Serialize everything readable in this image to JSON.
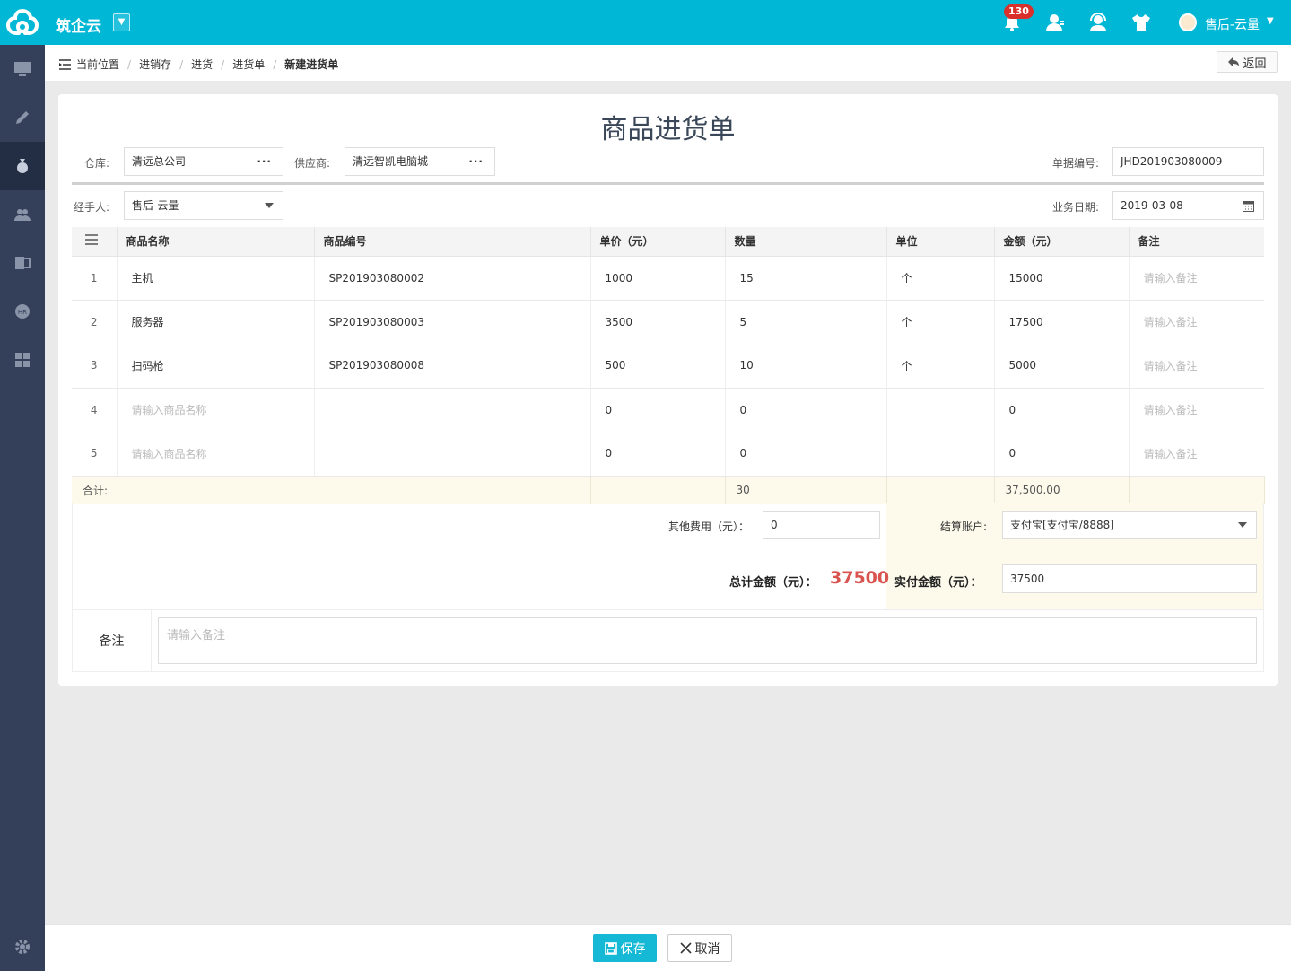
{
  "app": {
    "name": "筑企云",
    "notification_count": "130",
    "user_name": "售后-云量"
  },
  "breadcrumb": {
    "label": "当前位置",
    "items": [
      "进销存",
      "进货",
      "进货单"
    ],
    "current": "新建进货单"
  },
  "back_label": "返回",
  "form": {
    "title": "商品进货单",
    "warehouse": {
      "label": "仓库:",
      "value": "清远总公司"
    },
    "supplier": {
      "label": "供应商:",
      "value": "清远智凯电脑城"
    },
    "doc_no": {
      "label": "单据编号:",
      "value": "JHD201903080009"
    },
    "handler": {
      "label": "经手人:",
      "value": "售后-云量"
    },
    "biz_date": {
      "label": "业务日期:",
      "value": "2019-03-08"
    }
  },
  "table": {
    "headers": [
      "商品名称",
      "商品编号",
      "单价（元）",
      "数量",
      "单位",
      "金额（元）",
      "备注"
    ],
    "rows": [
      {
        "idx": "1",
        "name": "主机",
        "code": "SP201903080002",
        "price": "1000",
        "qty": "15",
        "unit": "个",
        "amount": "15000",
        "remark": "请输入备注"
      },
      {
        "idx": "2",
        "name": "服务器",
        "code": "SP201903080003",
        "price": "3500",
        "qty": "5",
        "unit": "个",
        "amount": "17500",
        "remark": "请输入备注"
      },
      {
        "idx": "3",
        "name": "扫码枪",
        "code": "SP201903080008",
        "price": "500",
        "qty": "10",
        "unit": "个",
        "amount": "5000",
        "remark": "请输入备注"
      },
      {
        "idx": "4",
        "name": "请输入商品名称",
        "code": "",
        "price": "0",
        "qty": "0",
        "unit": "",
        "amount": "0",
        "remark": "请输入备注"
      },
      {
        "idx": "5",
        "name": "请输入商品名称",
        "code": "",
        "price": "0",
        "qty": "0",
        "unit": "",
        "amount": "0",
        "remark": "请输入备注"
      }
    ],
    "summary": {
      "label": "合计:",
      "qty": "30",
      "amount": "37,500.00"
    }
  },
  "fees": {
    "other_label": "其他费用（元）：",
    "other_value": "0",
    "account_label": "结算账户:",
    "account_value": "支付宝[支付宝/8888]"
  },
  "totals": {
    "total_label": "总计金额（元）：",
    "total_value": "37500",
    "paid_label": "实付金额（元）：",
    "paid_value": "37500"
  },
  "remark": {
    "label": "备注",
    "placeholder": "请输入备注"
  },
  "actions": {
    "save": "保存",
    "cancel": "取消"
  },
  "colors": {
    "brand": "#00b7d6",
    "sidebar": "#34405a",
    "total": "#d9534f"
  }
}
